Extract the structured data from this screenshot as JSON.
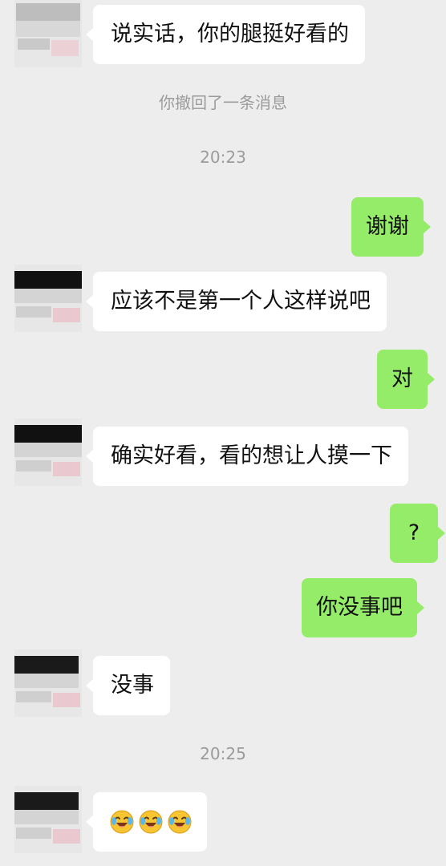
{
  "chat": {
    "messages": [
      {
        "side": "left",
        "text": "说实话，你的腿挺好看的"
      },
      {
        "type": "system",
        "text": "你撤回了一条消息"
      },
      {
        "type": "time",
        "text": "20:23"
      },
      {
        "side": "right",
        "text": "谢谢"
      },
      {
        "side": "left",
        "text": "应该不是第一个人这样说吧"
      },
      {
        "side": "right",
        "text": "对"
      },
      {
        "side": "left",
        "text": "确实好看，看的想让人摸一下"
      },
      {
        "side": "right",
        "text": "?"
      },
      {
        "side": "right",
        "text": "你没事吧"
      },
      {
        "side": "left",
        "text": "没事"
      },
      {
        "type": "time",
        "text": "20:25"
      },
      {
        "side": "left",
        "emoji": [
          "crying-laughing-face",
          "crying-laughing-face",
          "crying-laughing-face"
        ]
      }
    ]
  },
  "colors": {
    "background": "#ededed",
    "incoming_bubble": "#ffffff",
    "outgoing_bubble": "#95ec69",
    "system_text": "#9b9b9b"
  }
}
